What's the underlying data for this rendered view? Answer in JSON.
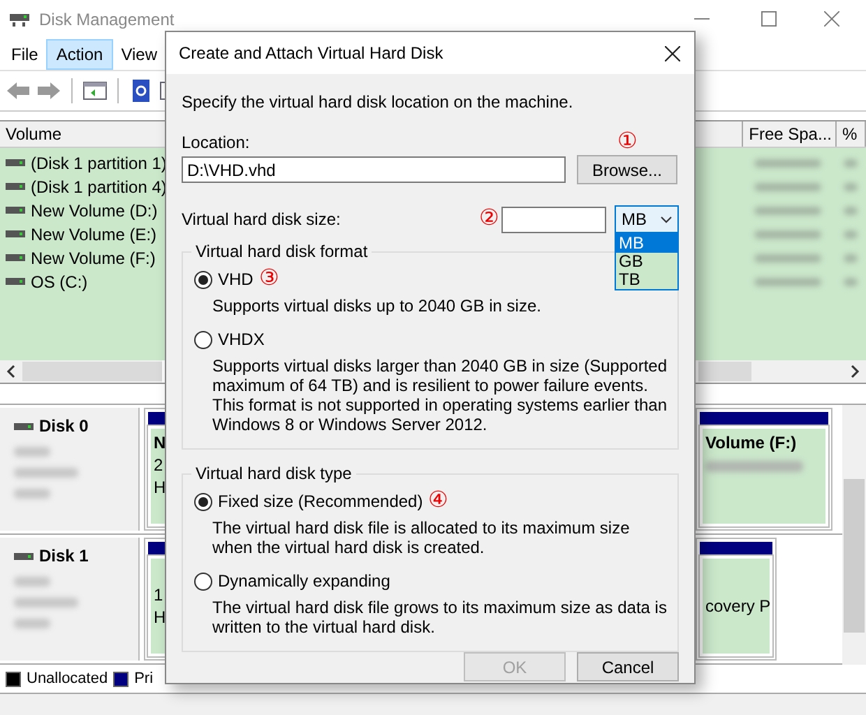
{
  "window": {
    "title": "Disk Management"
  },
  "menu": [
    {
      "label": "File",
      "selected": false
    },
    {
      "label": "Action",
      "selected": true
    },
    {
      "label": "View",
      "selected": false
    }
  ],
  "volume_table": {
    "columns": [
      "Volume",
      "Free Spa...",
      "%"
    ],
    "rows": [
      "(Disk 1 partition 1)",
      "(Disk 1 partition 4)",
      "New Volume (D:)",
      "New Volume (E:)",
      "New Volume (F:)",
      "OS (C:)"
    ]
  },
  "disks": [
    {
      "name": "Disk 0",
      "partitions": [
        {
          "title": "N",
          "lines": [
            "2",
            "H"
          ]
        },
        {
          "title": "Volume  (F:)"
        }
      ]
    },
    {
      "name": "Disk 1",
      "partitions": [
        {
          "lines": [
            "1",
            "H"
          ]
        },
        {
          "lines": [
            "covery P"
          ]
        }
      ]
    }
  ],
  "legend": [
    {
      "label": "Unallocated",
      "color": "#000000"
    },
    {
      "label": "Pri",
      "color": "#000080"
    }
  ],
  "dialog": {
    "title": "Create and Attach Virtual Hard Disk",
    "instruction": "Specify the virtual hard disk location on the machine.",
    "location": {
      "label": "Location:",
      "value": "D:\\VHD.vhd",
      "browse": "Browse...",
      "marker": "①"
    },
    "size": {
      "label": "Virtual hard disk size:",
      "marker": "②",
      "unit": "MB",
      "unit_options": [
        {
          "label": "MB",
          "selected": true
        },
        {
          "label": "GB",
          "selected": false
        },
        {
          "label": "TB",
          "selected": false
        }
      ]
    },
    "groups": [
      {
        "legend": "Virtual hard disk format",
        "options": [
          {
            "label": "VHD",
            "selected": true,
            "marker": "③",
            "description": "Supports virtual disks up to 2040 GB in size."
          },
          {
            "label": "VHDX",
            "selected": false,
            "description": "Supports virtual disks larger than 2040 GB in size (Supported maximum of 64 TB) and is resilient to power failure events. This format is not supported in operating systems earlier than Windows 8 or Windows Server 2012."
          }
        ]
      },
      {
        "legend": "Virtual hard disk type",
        "options": [
          {
            "label": "Fixed size (Recommended)",
            "selected": true,
            "marker": "④",
            "description": "The virtual hard disk file is allocated to its maximum size when the virtual hard disk is created."
          },
          {
            "label": "Dynamically expanding",
            "selected": false,
            "description": "The virtual hard disk file grows to its maximum size as data is written to the virtual hard disk."
          }
        ]
      }
    ],
    "buttons": [
      {
        "label": "OK",
        "disabled": true
      },
      {
        "label": "Cancel",
        "disabled": false
      }
    ]
  }
}
